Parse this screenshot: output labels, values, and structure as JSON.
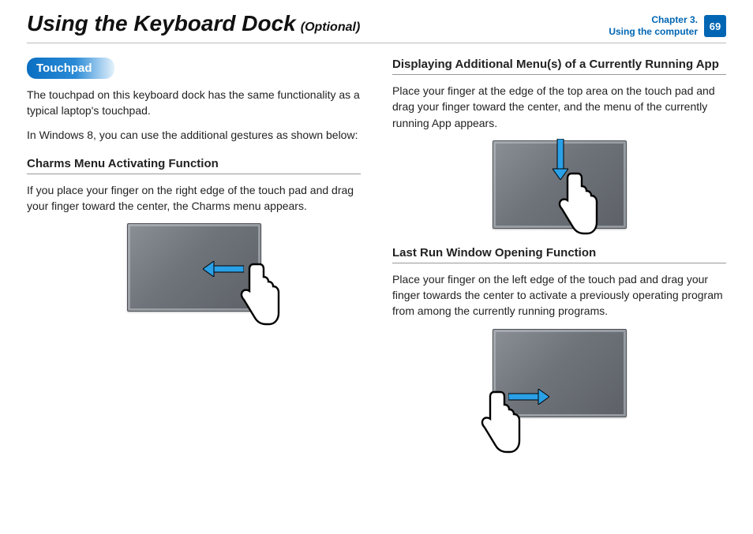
{
  "header": {
    "title": "Using the Keyboard Dock",
    "title_suffix": "(Optional)",
    "chapter_line1": "Chapter 3.",
    "chapter_line2": "Using the computer",
    "page_number": "69"
  },
  "left": {
    "section_label": "Touchpad",
    "intro_p1": "The touchpad on this keyboard dock has the same functionality as a typical laptop's touchpad.",
    "intro_p2": "In Windows 8, you can use the additional gestures as shown below:",
    "charms_heading": "Charms Menu Activating Function",
    "charms_body": "If you place your finger on the right edge of the touch pad and drag your finger toward the center, the Charms menu appears."
  },
  "right": {
    "display_heading": "Displaying Additional Menu(s) of a Currently Running App",
    "display_body": "Place your finger at the edge of the top area on the touch pad and drag your finger toward the center, and the menu of the currently running App appears.",
    "last_heading": "Last Run Window Opening Function",
    "last_body": "Place your finger on the left edge of the touch pad and drag your finger towards the center to activate a previously operating program from among the currently running programs."
  }
}
